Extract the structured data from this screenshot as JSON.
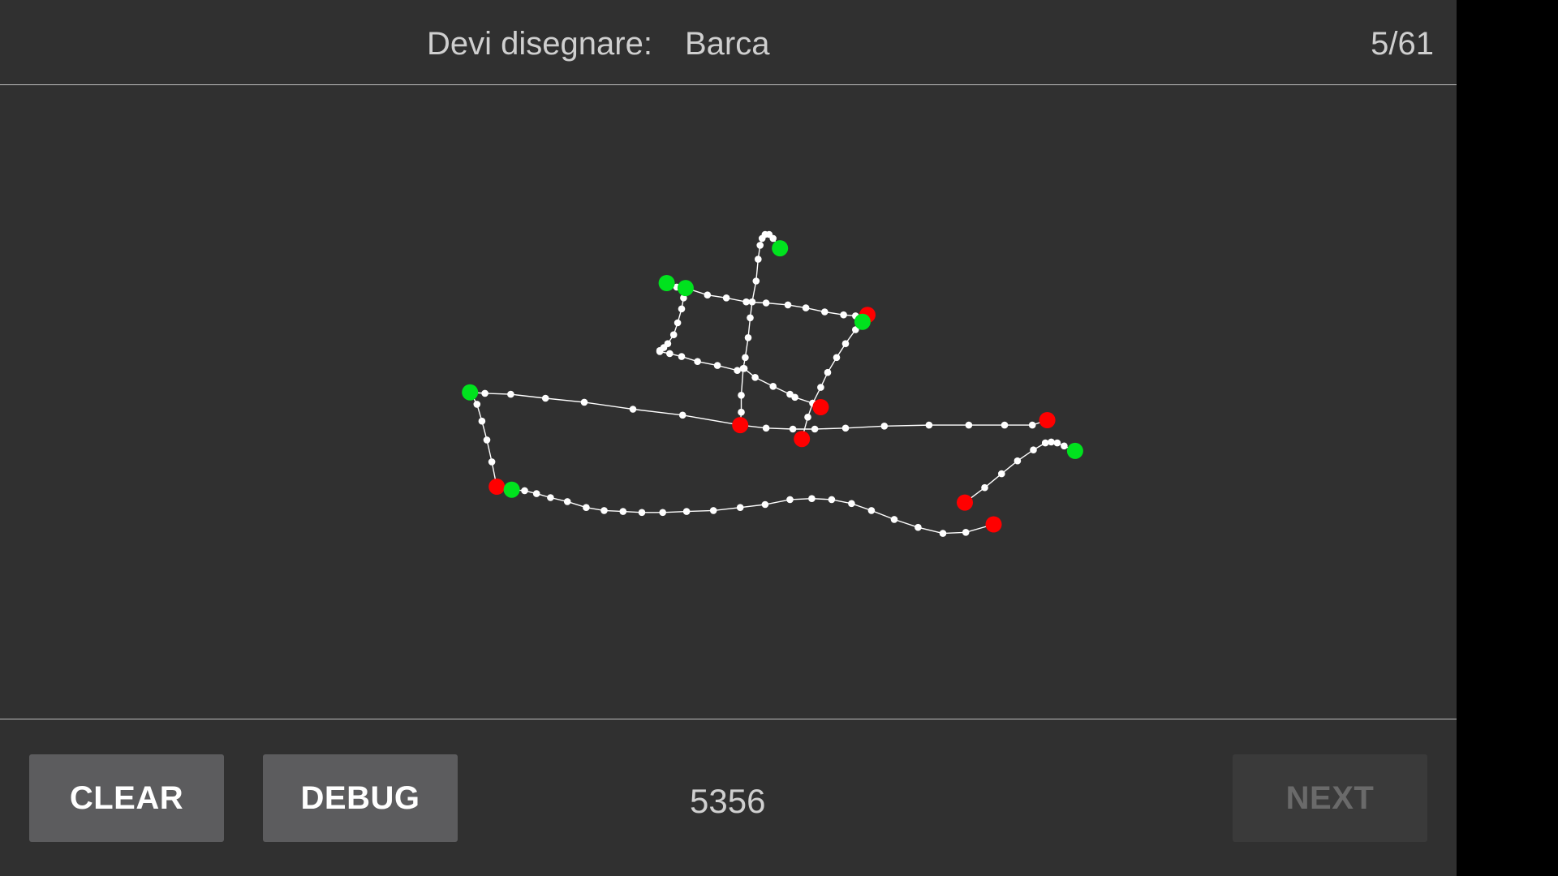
{
  "header": {
    "prompt_label": "Devi disegnare:",
    "prompt_word": "Barca",
    "counter": "5/61"
  },
  "footer": {
    "clear_label": "CLEAR",
    "debug_label": "DEBUG",
    "score": "5356",
    "next_label": "NEXT"
  },
  "colors": {
    "background": "#303030",
    "stroke": "#ffffff",
    "stroke_start": "#00e21e",
    "stroke_end": "#ff0000",
    "button": "#5c5c5e",
    "button_disabled": "#3a3a3a"
  }
}
